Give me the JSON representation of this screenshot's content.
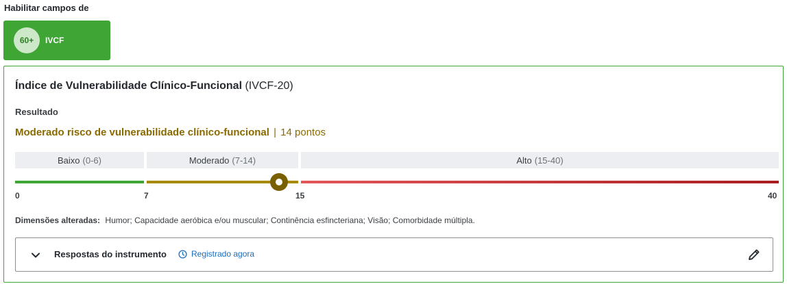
{
  "enable_fields_label": "Habilitar campos de",
  "toggle": {
    "badge": "60+",
    "label": "IVCF"
  },
  "card": {
    "title_bold": "Índice de Vulnerabilidade Clínico-Funcional",
    "title_suffix": "(IVCF-20)",
    "result_label": "Resultado",
    "result_text": "Moderado risco de vulnerabilidade clínico-funcional",
    "result_separator": "|",
    "result_points": "14 pontos",
    "score_value": 14,
    "ranges": [
      {
        "label": "Baixo",
        "value": "(0-6)"
      },
      {
        "label": "Moderado",
        "value": "(7-14)"
      },
      {
        "label": "Alto",
        "value": "(15-40)"
      }
    ],
    "ticks": [
      "0",
      "7",
      "15",
      "40"
    ],
    "colors": {
      "low": "#3fa535",
      "moderate": "#a88a00",
      "high": "#c62828"
    },
    "dimensions_label": "Dimensões alteradas:",
    "dimensions_value": "Humor; Capacidade aeróbica e/ou muscular; Continência esfincteriana; Visão; Comorbidade múltipla.",
    "responses": {
      "title": "Respostas do instrumento",
      "registered": "Registrado agora",
      "icons": {
        "expand": "chevron-down-icon",
        "time": "clock-icon",
        "edit": "pencil-icon"
      }
    }
  }
}
